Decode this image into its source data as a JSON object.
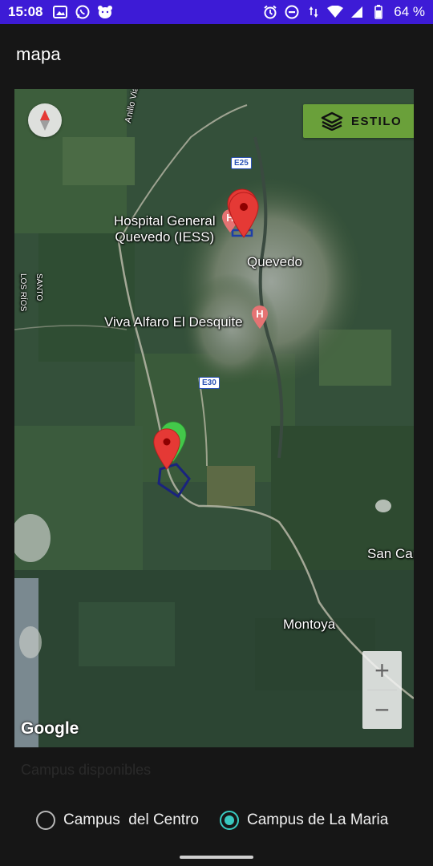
{
  "status_bar": {
    "time": "15:08",
    "left_icons": [
      "gallery-icon",
      "whatsapp-icon",
      "bear-app-icon"
    ],
    "right_icons": [
      "alarm-icon",
      "dnd-icon",
      "data-arrows-icon",
      "wifi-icon",
      "signal-icon",
      "battery-icon"
    ],
    "battery": "64 %"
  },
  "toolbar": {
    "title": "mapa"
  },
  "map": {
    "style_button_label": "ESTILO",
    "style_button_icon": "layers-icon",
    "compass_icon": "compass-icon",
    "labels": {
      "hospital": "Hospital General\nQuevedo (IESS)",
      "city": "Quevedo",
      "viva": "Viva Alfaro El Desquite",
      "los_rios": "LOS RÍOS",
      "santo": "SANTO",
      "road_name": "Anillo Vial Quevedo Tramo II",
      "san_carlos": "San Car",
      "montoya": "Montoya"
    },
    "shields": {
      "e25": "E25",
      "e30": "E30"
    },
    "zoom_in": "+",
    "zoom_out": "−",
    "attribution": "Google",
    "colors": {
      "pin_red": "#e53935",
      "pin_green": "#43c84a",
      "campus_polygon": "#1a237e",
      "style_button": "#6aa03a"
    }
  },
  "campus_heading": "Campus disponibles",
  "radio_options": [
    {
      "label": "Campus  del Centro",
      "checked": false
    },
    {
      "label": "Campus de La Maria",
      "checked": true
    }
  ],
  "accent_color": "#39c9c0"
}
